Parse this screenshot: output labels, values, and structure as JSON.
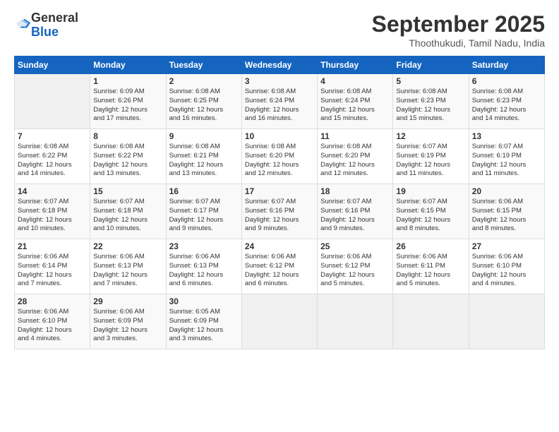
{
  "logo": {
    "general": "General",
    "blue": "Blue"
  },
  "header": {
    "title": "September 2025",
    "subtitle": "Thoothukudi, Tamil Nadu, India"
  },
  "days": [
    "Sunday",
    "Monday",
    "Tuesday",
    "Wednesday",
    "Thursday",
    "Friday",
    "Saturday"
  ],
  "weeks": [
    [
      {
        "day": "",
        "content": ""
      },
      {
        "day": "1",
        "content": "Sunrise: 6:09 AM\nSunset: 6:26 PM\nDaylight: 12 hours\nand 17 minutes."
      },
      {
        "day": "2",
        "content": "Sunrise: 6:08 AM\nSunset: 6:25 PM\nDaylight: 12 hours\nand 16 minutes."
      },
      {
        "day": "3",
        "content": "Sunrise: 6:08 AM\nSunset: 6:24 PM\nDaylight: 12 hours\nand 16 minutes."
      },
      {
        "day": "4",
        "content": "Sunrise: 6:08 AM\nSunset: 6:24 PM\nDaylight: 12 hours\nand 15 minutes."
      },
      {
        "day": "5",
        "content": "Sunrise: 6:08 AM\nSunset: 6:23 PM\nDaylight: 12 hours\nand 15 minutes."
      },
      {
        "day": "6",
        "content": "Sunrise: 6:08 AM\nSunset: 6:23 PM\nDaylight: 12 hours\nand 14 minutes."
      }
    ],
    [
      {
        "day": "7",
        "content": "Sunrise: 6:08 AM\nSunset: 6:22 PM\nDaylight: 12 hours\nand 14 minutes."
      },
      {
        "day": "8",
        "content": "Sunrise: 6:08 AM\nSunset: 6:22 PM\nDaylight: 12 hours\nand 13 minutes."
      },
      {
        "day": "9",
        "content": "Sunrise: 6:08 AM\nSunset: 6:21 PM\nDaylight: 12 hours\nand 13 minutes."
      },
      {
        "day": "10",
        "content": "Sunrise: 6:08 AM\nSunset: 6:20 PM\nDaylight: 12 hours\nand 12 minutes."
      },
      {
        "day": "11",
        "content": "Sunrise: 6:08 AM\nSunset: 6:20 PM\nDaylight: 12 hours\nand 12 minutes."
      },
      {
        "day": "12",
        "content": "Sunrise: 6:07 AM\nSunset: 6:19 PM\nDaylight: 12 hours\nand 11 minutes."
      },
      {
        "day": "13",
        "content": "Sunrise: 6:07 AM\nSunset: 6:19 PM\nDaylight: 12 hours\nand 11 minutes."
      }
    ],
    [
      {
        "day": "14",
        "content": "Sunrise: 6:07 AM\nSunset: 6:18 PM\nDaylight: 12 hours\nand 10 minutes."
      },
      {
        "day": "15",
        "content": "Sunrise: 6:07 AM\nSunset: 6:18 PM\nDaylight: 12 hours\nand 10 minutes."
      },
      {
        "day": "16",
        "content": "Sunrise: 6:07 AM\nSunset: 6:17 PM\nDaylight: 12 hours\nand 9 minutes."
      },
      {
        "day": "17",
        "content": "Sunrise: 6:07 AM\nSunset: 6:16 PM\nDaylight: 12 hours\nand 9 minutes."
      },
      {
        "day": "18",
        "content": "Sunrise: 6:07 AM\nSunset: 6:16 PM\nDaylight: 12 hours\nand 9 minutes."
      },
      {
        "day": "19",
        "content": "Sunrise: 6:07 AM\nSunset: 6:15 PM\nDaylight: 12 hours\nand 8 minutes."
      },
      {
        "day": "20",
        "content": "Sunrise: 6:06 AM\nSunset: 6:15 PM\nDaylight: 12 hours\nand 8 minutes."
      }
    ],
    [
      {
        "day": "21",
        "content": "Sunrise: 6:06 AM\nSunset: 6:14 PM\nDaylight: 12 hours\nand 7 minutes."
      },
      {
        "day": "22",
        "content": "Sunrise: 6:06 AM\nSunset: 6:13 PM\nDaylight: 12 hours\nand 7 minutes."
      },
      {
        "day": "23",
        "content": "Sunrise: 6:06 AM\nSunset: 6:13 PM\nDaylight: 12 hours\nand 6 minutes."
      },
      {
        "day": "24",
        "content": "Sunrise: 6:06 AM\nSunset: 6:12 PM\nDaylight: 12 hours\nand 6 minutes."
      },
      {
        "day": "25",
        "content": "Sunrise: 6:06 AM\nSunset: 6:12 PM\nDaylight: 12 hours\nand 5 minutes."
      },
      {
        "day": "26",
        "content": "Sunrise: 6:06 AM\nSunset: 6:11 PM\nDaylight: 12 hours\nand 5 minutes."
      },
      {
        "day": "27",
        "content": "Sunrise: 6:06 AM\nSunset: 6:10 PM\nDaylight: 12 hours\nand 4 minutes."
      }
    ],
    [
      {
        "day": "28",
        "content": "Sunrise: 6:06 AM\nSunset: 6:10 PM\nDaylight: 12 hours\nand 4 minutes."
      },
      {
        "day": "29",
        "content": "Sunrise: 6:06 AM\nSunset: 6:09 PM\nDaylight: 12 hours\nand 3 minutes."
      },
      {
        "day": "30",
        "content": "Sunrise: 6:05 AM\nSunset: 6:09 PM\nDaylight: 12 hours\nand 3 minutes."
      },
      {
        "day": "",
        "content": ""
      },
      {
        "day": "",
        "content": ""
      },
      {
        "day": "",
        "content": ""
      },
      {
        "day": "",
        "content": ""
      }
    ]
  ]
}
